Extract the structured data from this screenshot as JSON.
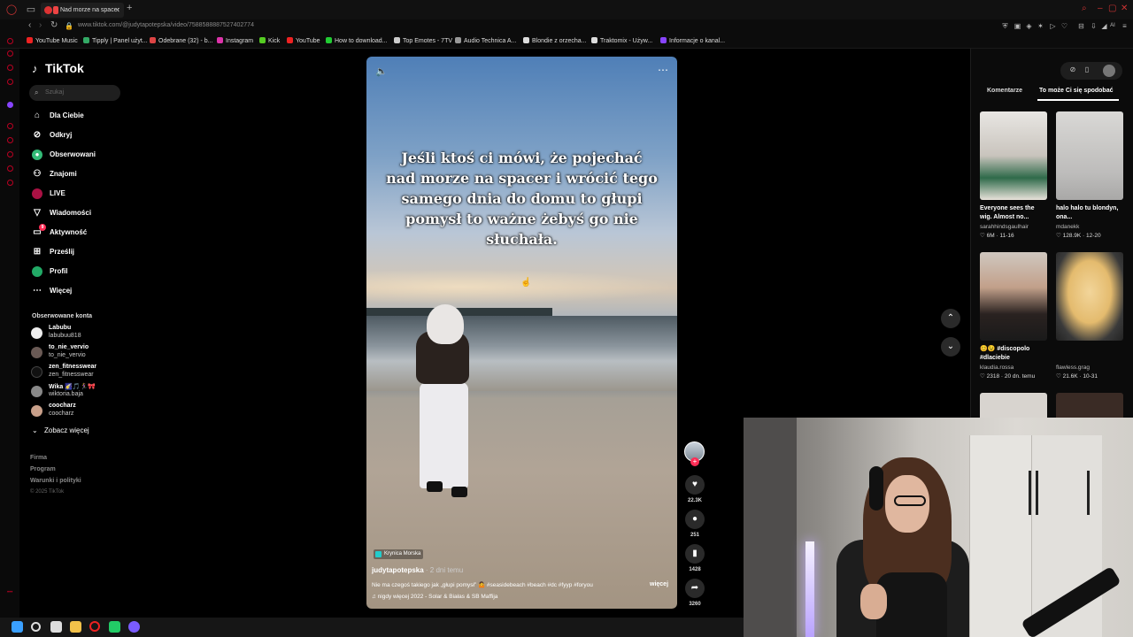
{
  "browser": {
    "tab_title": "Nad morze na spacer",
    "url": "www.tiktok.com/@judytapotepska/video/7588588887527402774",
    "ai_label": "AI",
    "bookmarks": [
      "YouTube Music",
      "Tipply | Panel użyt...",
      "Odebrane (32) - b...",
      "Instagram",
      "Kick",
      "YouTube",
      "How to download...",
      "Top Emotes - 7TV",
      "Audio Technica A...",
      "Blondie z orzecha...",
      "Traktomix - Używ...",
      "Informacje o kanal..."
    ]
  },
  "tiktok": {
    "logo": "TikTok",
    "search_placeholder": "Szukaj",
    "nav": [
      {
        "label": "Dla Ciebie",
        "icon": "home-icon"
      },
      {
        "label": "Odkryj",
        "icon": "compass-icon"
      },
      {
        "label": "Obserwowani",
        "icon": "following-icon"
      },
      {
        "label": "Znajomi",
        "icon": "friends-icon"
      },
      {
        "label": "LIVE",
        "icon": "live-icon"
      },
      {
        "label": "Wiadomości",
        "icon": "messages-icon"
      },
      {
        "label": "Aktywność",
        "icon": "activity-icon",
        "badge": "9"
      },
      {
        "label": "Prześlij",
        "icon": "upload-icon"
      },
      {
        "label": "Profil",
        "icon": "profile-icon"
      },
      {
        "label": "Więcej",
        "icon": "more-icon"
      }
    ],
    "followed_heading": "Obserwowane konta",
    "followed": [
      {
        "name": "Labubu",
        "handle": "labubuu818"
      },
      {
        "name": "to_nie_vervio",
        "handle": "to_nie_vervio"
      },
      {
        "name": "zen_fitnesswear",
        "handle": "zen_fitnesswear"
      },
      {
        "name": "Wika 🌠🎵🏃‍♀️🎀",
        "handle": "wiktoria.baja"
      },
      {
        "name": "coocharz",
        "handle": "coocharz"
      }
    ],
    "see_more": "Zobacz więcej",
    "footer": [
      "Firma",
      "Program",
      "Warunki i polityki"
    ],
    "copyright": "© 2025 TikTok"
  },
  "video": {
    "caption": "Jeśli ktoś ci mówi, że pojechać nad morze na spacer i wrócić tego samego dnia do domu to głupi pomysł to ważne żebyś go nie słuchała.",
    "location": "Krynica Morska",
    "author": "judytapotepska",
    "date": "· 2 dni temu",
    "description": "Nie ma czegoś takiego jak „głupi pomysł” 🤷 #seasidebeach #beach #dc #fyyp #foryou",
    "more": "więcej",
    "music": "♫ nigdy więcej 2022 - Solar & Białas & SB Maffija",
    "likes": "22.3K",
    "comments": "251",
    "saves": "1428",
    "shares": "3260"
  },
  "right_panel": {
    "tab_comments": "Komentarze",
    "tab_related": "To może Ci się spodobać",
    "cards": [
      {
        "title": "Everyone sees the wig. Almost no...",
        "user": "sarahhindsgaulhair",
        "stats": "♡ 6M · 11-16"
      },
      {
        "title": "halo halo tu blondyn, ona...",
        "user": "mdanekk",
        "stats": "♡ 128.9K · 12-20"
      },
      {
        "title": "😊😉 #discopolo #dlaciebie",
        "user": "klaudia.rossa",
        "stats": "♡ 2318 · 20 dn. temu"
      },
      {
        "title": "",
        "user": "flawless.grag",
        "stats": "♡ 21.6K · 10-31"
      }
    ]
  }
}
